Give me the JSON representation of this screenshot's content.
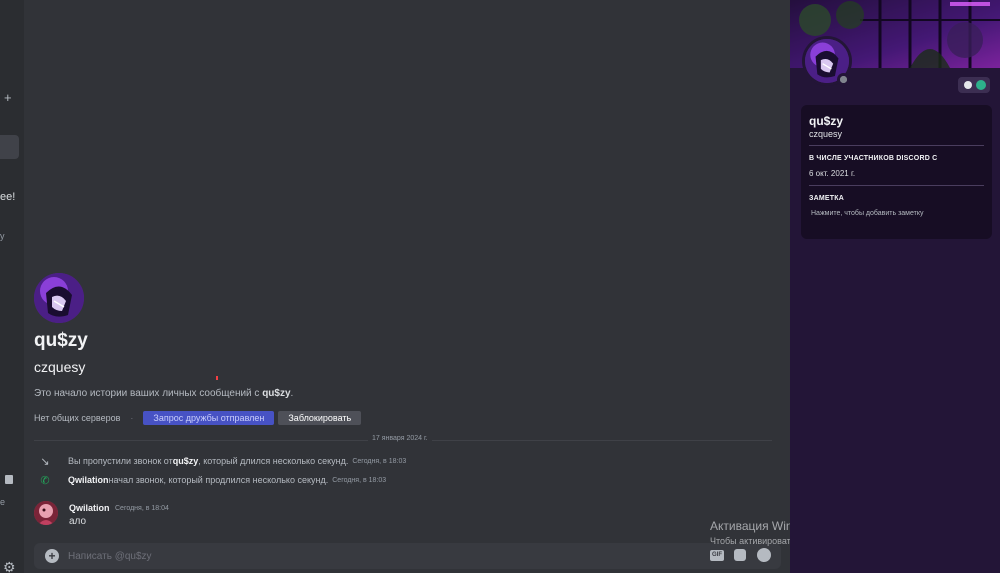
{
  "sidebar": {
    "add_label": "+",
    "fragment_1": "ee!",
    "fragment_2": "y",
    "fragment_3": "e"
  },
  "profile_header": {
    "display_name": "qu$zy",
    "username": "czquesy",
    "intro_text": "Это начало истории ваших личных сообщений с ",
    "intro_name": "qu$zy",
    "intro_end": ".",
    "no_common_servers": "Нет общих серверов",
    "separator": "·",
    "friend_request_button": "Запрос дружбы отправлен",
    "block_button": "Заблокировать"
  },
  "chat": {
    "date_divider": "17 января 2024 г.",
    "system_messages": [
      {
        "icon": "missed-call-icon",
        "prefix": "Вы пропустили звонок от ",
        "name": "qu$zy",
        "suffix": ", который длился несколько секунд.",
        "timestamp": "Сегодня, в 18:03"
      },
      {
        "icon": "call-icon",
        "prefix": "",
        "name": "Qwilation",
        "suffix": " начал звонок, который продлился несколько секунд.",
        "timestamp": "Сегодня, в 18:03"
      }
    ],
    "messages": [
      {
        "author": "Qwilation",
        "timestamp": "Сегодня, в 18:04",
        "text": "ало"
      }
    ]
  },
  "composer": {
    "placeholder": "Написать @qu$zy",
    "gif_label": "GIF"
  },
  "windows_watermark": {
    "title": "Активация Windows",
    "subtitle": "Чтобы активировать Windows, перейдите в раздел \"Параметры\"."
  },
  "profile_panel": {
    "display_name": "qu$zy",
    "username": "czquesy",
    "member_since_heading": "В ЧИСЛЕ УЧАСТНИКОВ DISCORD С",
    "member_since": "6 окт. 2021 г.",
    "note_heading": "ЗАМЕТКА",
    "note_placeholder": "Нажмите, чтобы добавить заметку"
  },
  "colors": {
    "background": "#313338",
    "accent_button": "#4752c4",
    "panel": "#231537",
    "call_green": "#23a55a"
  }
}
